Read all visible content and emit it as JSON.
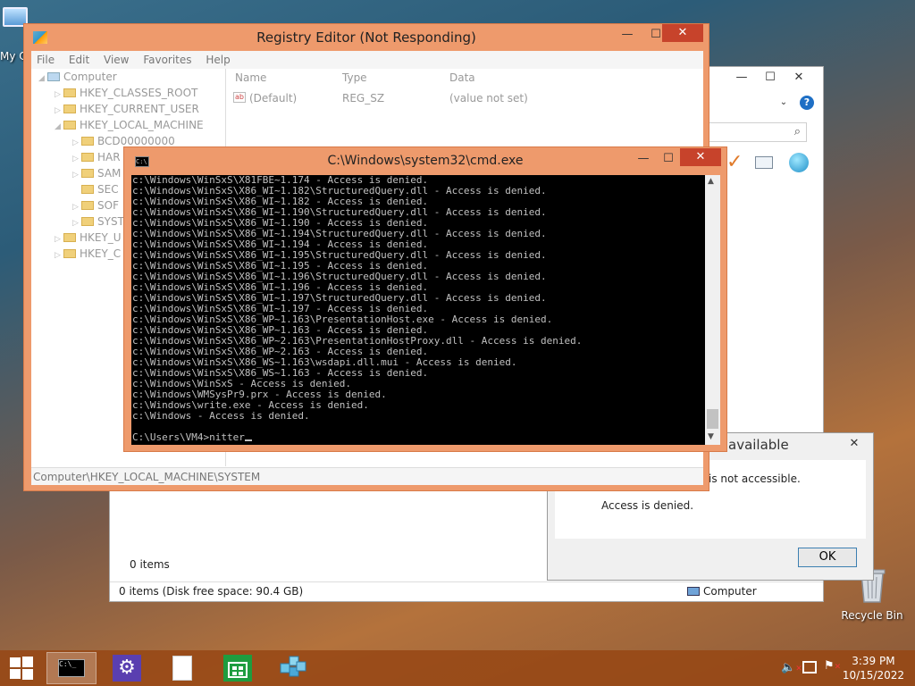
{
  "desktop": {
    "mycomputer_label": "My C",
    "recycle_label": "Recycle Bin"
  },
  "explorer": {
    "items_count": "0 items",
    "status_text": "0 items (Disk free space: 90.4 GB)",
    "status_location": "Computer",
    "search_icon": "magnifier-icon",
    "help_icon": "help-icon"
  },
  "dialog": {
    "title": "available",
    "message": "is not accessible.",
    "detail": "Access is denied.",
    "ok_label": "OK"
  },
  "regedit": {
    "title": "Registry Editor (Not Responding)",
    "menu": [
      "File",
      "Edit",
      "View",
      "Favorites",
      "Help"
    ],
    "tree": {
      "root": "Computer",
      "hkcr": "HKEY_CLASSES_ROOT",
      "hkcu": "HKEY_CURRENT_USER",
      "hklm": "HKEY_LOCAL_MACHINE",
      "bcd": "BCD00000000",
      "har": "HAR",
      "sam": "SAM",
      "sec": "SEC",
      "sof": "SOF",
      "sys": "SYST",
      "hku": "HKEY_U",
      "hkcc": "HKEY_C"
    },
    "columns": {
      "name": "Name",
      "type": "Type",
      "data": "Data"
    },
    "row": {
      "name": "(Default)",
      "type": "REG_SZ",
      "data": "(value not set)"
    },
    "status": "Computer\\HKEY_LOCAL_MACHINE\\SYSTEM"
  },
  "cmd": {
    "title": "C:\\Windows\\system32\\cmd.exe",
    "lines": [
      "c:\\Windows\\WinSxS\\X81FBE~1.174 - Access is denied.",
      "c:\\Windows\\WinSxS\\X86_WI~1.182\\StructuredQuery.dll - Access is denied.",
      "c:\\Windows\\WinSxS\\X86_WI~1.182 - Access is denied.",
      "c:\\Windows\\WinSxS\\X86_WI~1.190\\StructuredQuery.dll - Access is denied.",
      "c:\\Windows\\WinSxS\\X86_WI~1.190 - Access is denied.",
      "c:\\Windows\\WinSxS\\X86_WI~1.194\\StructuredQuery.dll - Access is denied.",
      "c:\\Windows\\WinSxS\\X86_WI~1.194 - Access is denied.",
      "c:\\Windows\\WinSxS\\X86_WI~1.195\\StructuredQuery.dll - Access is denied.",
      "c:\\Windows\\WinSxS\\X86_WI~1.195 - Access is denied.",
      "c:\\Windows\\WinSxS\\X86_WI~1.196\\StructuredQuery.dll - Access is denied.",
      "c:\\Windows\\WinSxS\\X86_WI~1.196 - Access is denied.",
      "c:\\Windows\\WinSxS\\X86_WI~1.197\\StructuredQuery.dll - Access is denied.",
      "c:\\Windows\\WinSxS\\X86_WI~1.197 - Access is denied.",
      "c:\\Windows\\WinSxS\\X86_WP~1.163\\PresentationHost.exe - Access is denied.",
      "c:\\Windows\\WinSxS\\X86_WP~1.163 - Access is denied.",
      "c:\\Windows\\WinSxS\\X86_WP~2.163\\PresentationHostProxy.dll - Access is denied.",
      "c:\\Windows\\WinSxS\\X86_WP~2.163 - Access is denied.",
      "c:\\Windows\\WinSxS\\X86_WS~1.163\\wsdapi.dll.mui - Access is denied.",
      "c:\\Windows\\WinSxS\\X86_WS~1.163 - Access is denied.",
      "c:\\Windows\\WinSxS - Access is denied.",
      "c:\\Windows\\WMSysPr9.prx - Access is denied.",
      "c:\\Windows\\write.exe - Access is denied.",
      "c:\\Windows - Access is denied.",
      "",
      "C:\\Users\\VM4>nitter"
    ]
  },
  "taskbar": {
    "time": "3:39 PM",
    "date": "10/15/2022"
  },
  "colors": {
    "active_frame": "#ee9a6c",
    "close_button": "#c7432b",
    "taskbar": "#96461a"
  }
}
